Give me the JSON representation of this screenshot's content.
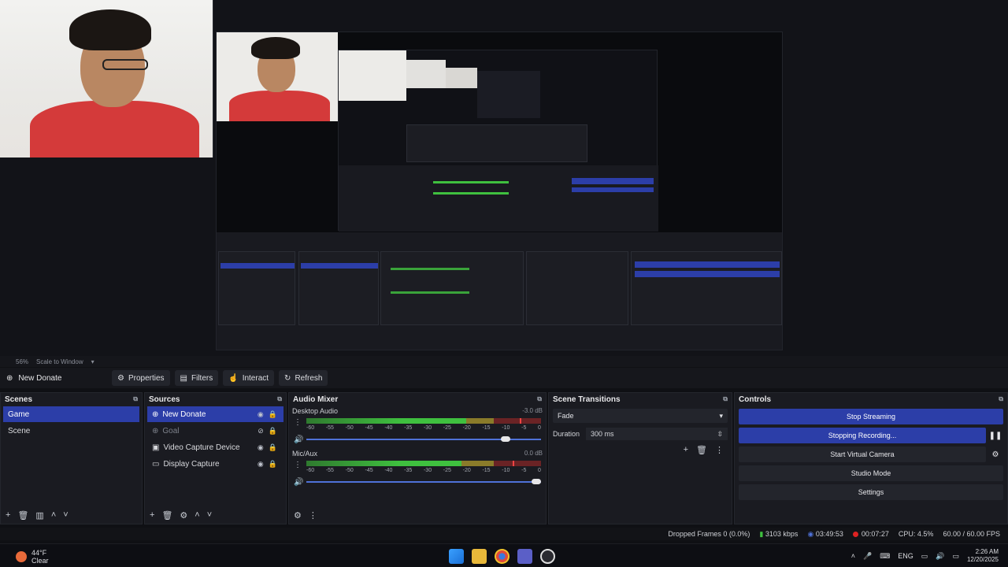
{
  "window": {
    "controls": [
      "—",
      "▢",
      "✕"
    ]
  },
  "preview": {
    "zoom": "56%",
    "scale_mode": "Scale to Window"
  },
  "toolbar": {
    "source_name": "New Donate",
    "properties": "Properties",
    "filters": "Filters",
    "interact": "Interact",
    "refresh": "Refresh"
  },
  "scenes": {
    "title": "Scenes",
    "items": [
      "Game",
      "Scene"
    ],
    "selected": "Game"
  },
  "sources": {
    "title": "Sources",
    "items": [
      {
        "label": "New Donate",
        "icon": "browser-icon",
        "selected": true,
        "visible": true
      },
      {
        "label": "Goal",
        "icon": "browser-icon",
        "selected": false,
        "visible": false
      },
      {
        "label": "Video Capture Device",
        "icon": "camera-icon",
        "selected": false,
        "visible": true
      },
      {
        "label": "Display Capture",
        "icon": "monitor-icon",
        "selected": false,
        "visible": true
      }
    ]
  },
  "mixer": {
    "title": "Audio Mixer",
    "ticks": [
      "-60",
      "-55",
      "-50",
      "-45",
      "-40",
      "-35",
      "-30",
      "-25",
      "-20",
      "-15",
      "-10",
      "-5",
      "0"
    ],
    "channels": [
      {
        "name": "Desktop Audio",
        "db": "-3.0 dB",
        "level": 0.68,
        "fader": 0.85
      },
      {
        "name": "Mic/Aux",
        "db": "0.0 dB",
        "level": 0.66,
        "fader": 0.98
      }
    ]
  },
  "transitions": {
    "title": "Scene Transitions",
    "selected": "Fade",
    "duration_label": "Duration",
    "duration_value": "300 ms"
  },
  "controls": {
    "title": "Controls",
    "stop_streaming": "Stop Streaming",
    "stopping_recording": "Stopping Recording...",
    "start_virtual_camera": "Start Virtual Camera",
    "studio_mode": "Studio Mode",
    "settings": "Settings"
  },
  "status": {
    "dropped_frames": "Dropped Frames 0 (0.0%)",
    "bitrate": "3103 kbps",
    "stream_time": "03:49:53",
    "rec_time": "00:07:27",
    "cpu": "CPU: 4.5%",
    "fps": "60.00 / 60.00 FPS"
  },
  "taskbar": {
    "weather_temp": "44°F",
    "weather_desc": "Clear",
    "language": "ENG",
    "time": "2:26 AM",
    "date": "12/20/2025"
  },
  "colors": {
    "accent": "#2c3ea8",
    "meter_green": "#3fc03f",
    "record_red": "#d22222"
  }
}
